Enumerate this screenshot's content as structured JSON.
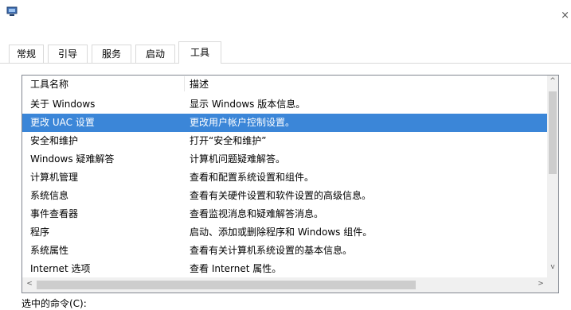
{
  "window": {
    "icon": "system-config-icon",
    "close_glyph": "×"
  },
  "tabs": [
    {
      "label": "常规",
      "active": false
    },
    {
      "label": "引导",
      "active": false
    },
    {
      "label": "服务",
      "active": false
    },
    {
      "label": "启动",
      "active": false
    },
    {
      "label": "工具",
      "active": true
    }
  ],
  "tools_list": {
    "columns": [
      "工具名称",
      "描述"
    ],
    "rows": [
      {
        "name": "关于 Windows",
        "desc": "显示 Windows 版本信息。",
        "selected": false
      },
      {
        "name": "更改 UAC 设置",
        "desc": "更改用户帐户控制设置。",
        "selected": true
      },
      {
        "name": "安全和维护",
        "desc": "打开“安全和维护”",
        "selected": false
      },
      {
        "name": "Windows 疑难解答",
        "desc": "计算机问题疑难解答。",
        "selected": false
      },
      {
        "name": "计算机管理",
        "desc": "查看和配置系统设置和组件。",
        "selected": false
      },
      {
        "name": "系统信息",
        "desc": "查看有关硬件设置和软件设置的高级信息。",
        "selected": false
      },
      {
        "name": "事件查看器",
        "desc": "查看监视消息和疑难解答消息。",
        "selected": false
      },
      {
        "name": "程序",
        "desc": "启动、添加或删除程序和 Windows 组件。",
        "selected": false
      },
      {
        "name": "系统属性",
        "desc": "查看有关计算机系统设置的基本信息。",
        "selected": false
      },
      {
        "name": "Internet 选项",
        "desc": "查看 Internet 属性。",
        "selected": false
      }
    ],
    "scroll_up": "^",
    "scroll_down": "v",
    "scroll_left": "<",
    "scroll_right": ">"
  },
  "selected_command_label": "选中的命令(C):",
  "colors": {
    "selection": "#3b86d8",
    "border": "#828790"
  }
}
